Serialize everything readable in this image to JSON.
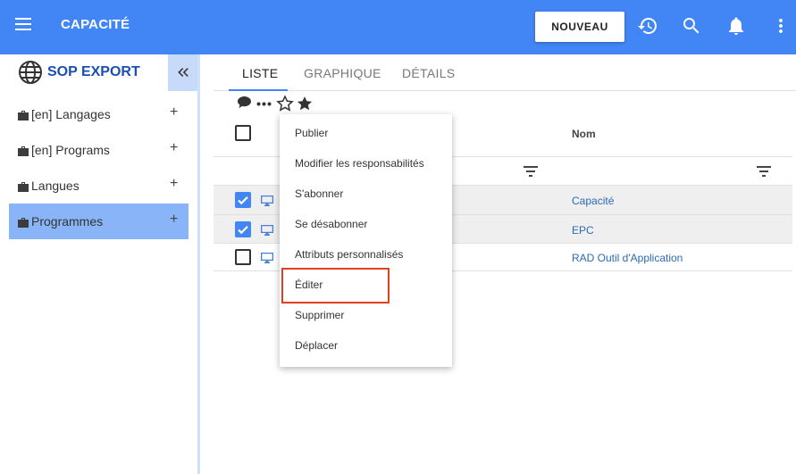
{
  "header": {
    "title": "CAPACITÉ",
    "new_button": "NOUVEAU",
    "icons": [
      "menu-icon",
      "history-icon",
      "search-icon",
      "bell-icon",
      "more-vert-icon"
    ],
    "background": "#4285f4"
  },
  "sidebar": {
    "brand": "SOP EXPORT",
    "items": [
      {
        "label": "[en] Langages",
        "active": false
      },
      {
        "label": "[en] Programs",
        "active": false
      },
      {
        "label": "Langues",
        "active": false
      },
      {
        "label": "Programmes",
        "active": true
      }
    ],
    "add_symbol": "+"
  },
  "tabs": [
    {
      "label": "LISTE",
      "active": true
    },
    {
      "label": "GRAPHIQUE",
      "active": false
    },
    {
      "label": "DÉTAILS",
      "active": false
    }
  ],
  "table": {
    "column_name": "Nom",
    "rows": [
      {
        "name": "Capacité",
        "checked": true
      },
      {
        "name": "EPC",
        "checked": true
      },
      {
        "name": "RAD Outil d'Application",
        "checked": false
      }
    ]
  },
  "context_menu": {
    "items": [
      "Publier",
      "Modifier les responsabilités",
      "S'abonner",
      "Se désabonner",
      "Attributs personnalisés",
      "Éditer",
      "Supprimer",
      "Déplacer"
    ],
    "highlighted": "Éditer",
    "highlight_color": "#e0401e"
  }
}
